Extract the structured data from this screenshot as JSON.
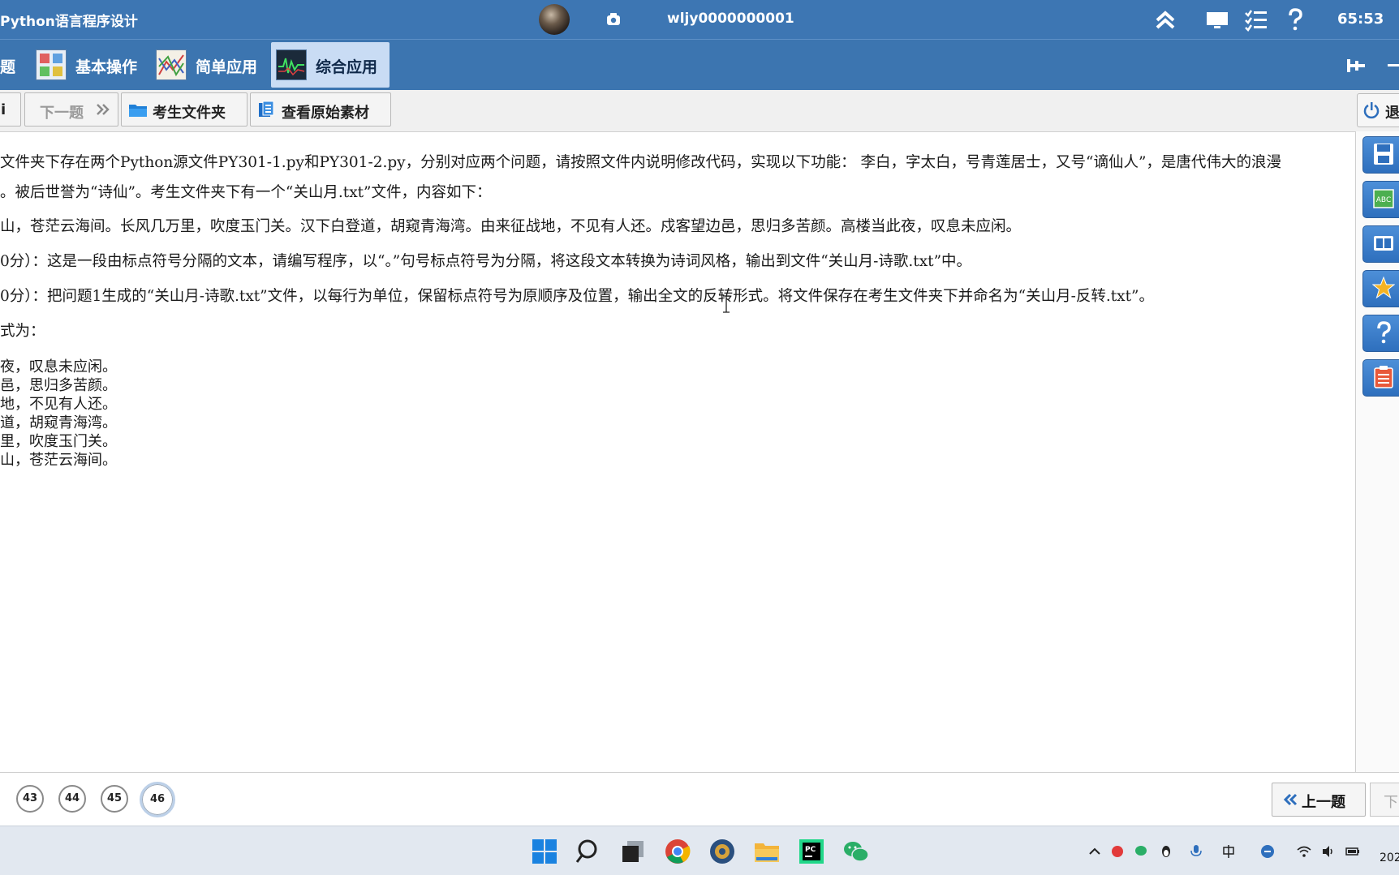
{
  "titlebar": {
    "app_title": "Python语言程序设计",
    "user_id": "wljy0000000001",
    "timer": "65:53"
  },
  "categories": [
    {
      "label": "题",
      "icon": "partial-tab-icon"
    },
    {
      "label": "基本操作",
      "icon": "basic-grid-icon"
    },
    {
      "label": "简单应用",
      "icon": "line-chart-icon"
    },
    {
      "label": "综合应用",
      "icon": "waveform-icon",
      "active": true
    }
  ],
  "toolbar": {
    "partial_label": "i",
    "next_label": "下一题",
    "folder_label": "考生文件夹",
    "material_label": "查看原始素材",
    "exit_label": "退"
  },
  "question": {
    "line1": "文件夹下存在两个Python源文件PY301-1.py和PY301-2.py，分别对应两个问题，请按照文件内说明修改代码，实现以下功能： 李白，字太白，号青莲居士，又号“谪仙人”，是唐代伟大的浪漫",
    "line2": "。被后世誉为“诗仙”。考生文件夹下有一个“关山月.txt”文件，内容如下：",
    "line3": "山，苍茫云海间。长风几万里，吹度玉门关。汉下白登道，胡窥青海湾。由来征战地，不见有人还。戍客望边邑，思归多苦颜。高楼当此夜，叹息未应闲。",
    "line4": "0分）：这是一段由标点符号分隔的文本，请编写程序，以“。”句号标点符号为分隔，将这段文本转换为诗词风格，输出到文件“关山月-诗歌.txt”中。",
    "line5": "0分）：把问题1生成的“关山月-诗歌.txt”文件，以每行为单位，保留标点符号为原顺序及位置，输出全文的反转形式。将文件保存在考生文件夹下并命名为“关山月-反转.txt”。",
    "line6": "式为：",
    "output_lines": [
      "夜，叹息未应闲。",
      "邑，思归多苦颜。",
      "地，不见有人还。",
      "道，胡窥青海湾。",
      "里，吹度玉门关。",
      "山，苍茫云海间。"
    ]
  },
  "question_numbers": [
    "43",
    "44",
    "45",
    "46"
  ],
  "current_question": "46",
  "bottom": {
    "prev_label": "上一题",
    "next_partial": "下"
  },
  "taskbar": {
    "clock_partial": "202"
  },
  "colors": {
    "header_blue": "#3d76b3",
    "active_tab": "#c9dcf4",
    "side_button_blue": "#2e6fbd"
  }
}
